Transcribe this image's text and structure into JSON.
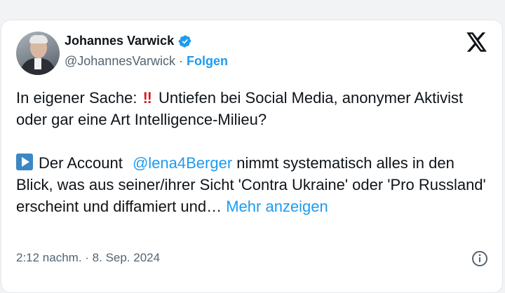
{
  "author": {
    "name": "Johannes Varwick",
    "handle": "@JohannesVarwick",
    "separator": "·",
    "follow_label": "Folgen"
  },
  "tweet": {
    "line1_prefix": "In eigener Sache:",
    "line1_emoji": "‼",
    "line1_rest": "Untiefen bei Social Media, anonymer Aktivist oder gar eine Art Intelligence-Milieu?",
    "para2_prefix": "Der Account",
    "mention": "@lena4Berger",
    "para2_rest": "nimmt systematisch alles in den Blick, was aus seiner/ihrer Sicht 'Contra Ukraine' oder 'Pro Russland' erscheint und diffamiert und…",
    "more_label": "Mehr anzeigen"
  },
  "timestamp": "2:12 nachm. · 8. Sep. 2024",
  "icons": {
    "verified": "verified-badge-icon",
    "x_logo": "x-logo-icon",
    "info": "info-icon",
    "play": "play-button-icon"
  },
  "colors": {
    "accent": "#1d9bf0",
    "text": "#0f1419",
    "muted": "#536471",
    "emoji_red": "#d31d24"
  }
}
